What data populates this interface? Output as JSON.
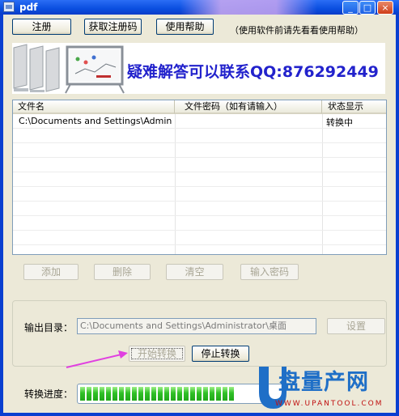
{
  "window": {
    "title": "pdf",
    "minimize_label": "_",
    "maximize_label": "□",
    "close_label": "×"
  },
  "toolbar": {
    "register_label": "注册",
    "get_code_label": "获取注册码",
    "help_label": "使用帮助",
    "hint": "（使用软件前请先看看使用帮助）"
  },
  "banner": {
    "title": "疑难解答可以联系QQ:876292449"
  },
  "file_list": {
    "columns": [
      "文件名",
      "文件密码（如有请输入）",
      "状态显示"
    ],
    "rows": [
      {
        "file_name": "C:\\Documents and Settings\\Administr...",
        "password": "",
        "status": "转换中"
      }
    ]
  },
  "list_actions": {
    "add_label": "添加",
    "delete_label": "删除",
    "clear_label": "清空",
    "password_label": "输入密码"
  },
  "output": {
    "label": "输出目录：",
    "path": "C:\\Documents and Settings\\Administrator\\桌面",
    "settings_label": "设置",
    "start_label": "开始转换",
    "stop_label": "停止转换"
  },
  "progress": {
    "label": "转换进度：",
    "fraction": 0.78,
    "color": "#2fc026"
  },
  "logo": {
    "text": "盘量产网",
    "url": "WWW.UPANTOOL.COM"
  },
  "colors": {
    "titlebar": "#0a4ee0",
    "window_bg": "#ece9d8",
    "banner_text": "#2222cc",
    "arrow": "#e040e0",
    "logo_blue": "#1f6fc7",
    "logo_red": "#c01010"
  }
}
